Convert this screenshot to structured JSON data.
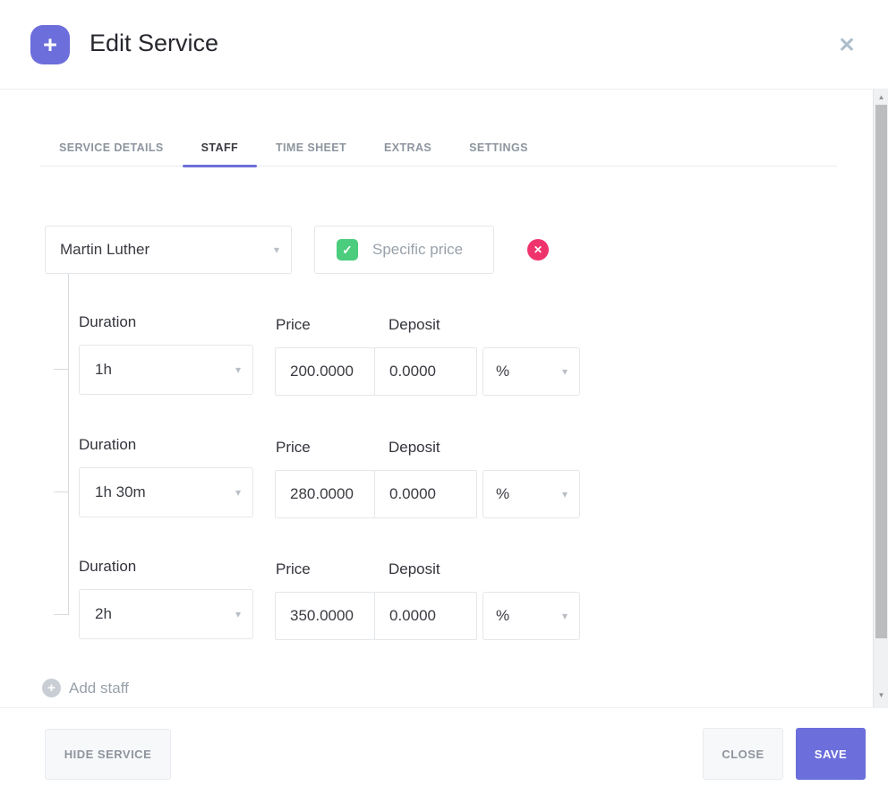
{
  "header": {
    "title": "Edit Service",
    "plus_icon": "+",
    "close_icon": "✕"
  },
  "tabs": [
    {
      "label": "SERVICE DETAILS",
      "active": false
    },
    {
      "label": "STAFF",
      "active": true
    },
    {
      "label": "TIME SHEET",
      "active": false
    },
    {
      "label": "EXTRAS",
      "active": false
    },
    {
      "label": "SETTINGS",
      "active": false
    }
  ],
  "staff": {
    "name_selected": "Martin Luther",
    "specific_price_label": "Specific price",
    "specific_price_checked": true,
    "check_icon": "✓",
    "remove_icon": "✕"
  },
  "pricing_rows": [
    {
      "duration_label": "Duration",
      "duration": "1h",
      "price_label": "Price",
      "price": "200.0000",
      "deposit_label": "Deposit",
      "deposit": "0.0000",
      "deposit_unit": "%"
    },
    {
      "duration_label": "Duration",
      "duration": "1h 30m",
      "price_label": "Price",
      "price": "280.0000",
      "deposit_label": "Deposit",
      "deposit": "0.0000",
      "deposit_unit": "%"
    },
    {
      "duration_label": "Duration",
      "duration": "2h",
      "price_label": "Price",
      "price": "350.0000",
      "deposit_label": "Deposit",
      "deposit": "0.0000",
      "deposit_unit": "%"
    }
  ],
  "add_staff": {
    "label": "Add staff",
    "plus_icon": "+"
  },
  "footer": {
    "hide_service_label": "HIDE SERVICE",
    "close_label": "CLOSE",
    "save_label": "SAVE"
  },
  "icons": {
    "caret": "▾",
    "scroll_up": "▲",
    "scroll_down": "▼"
  },
  "colors": {
    "accent_purple": "#6c6edb",
    "check_green": "#4bcd7d",
    "remove_red": "#ef346c",
    "gray_text": "#99a1aa"
  }
}
